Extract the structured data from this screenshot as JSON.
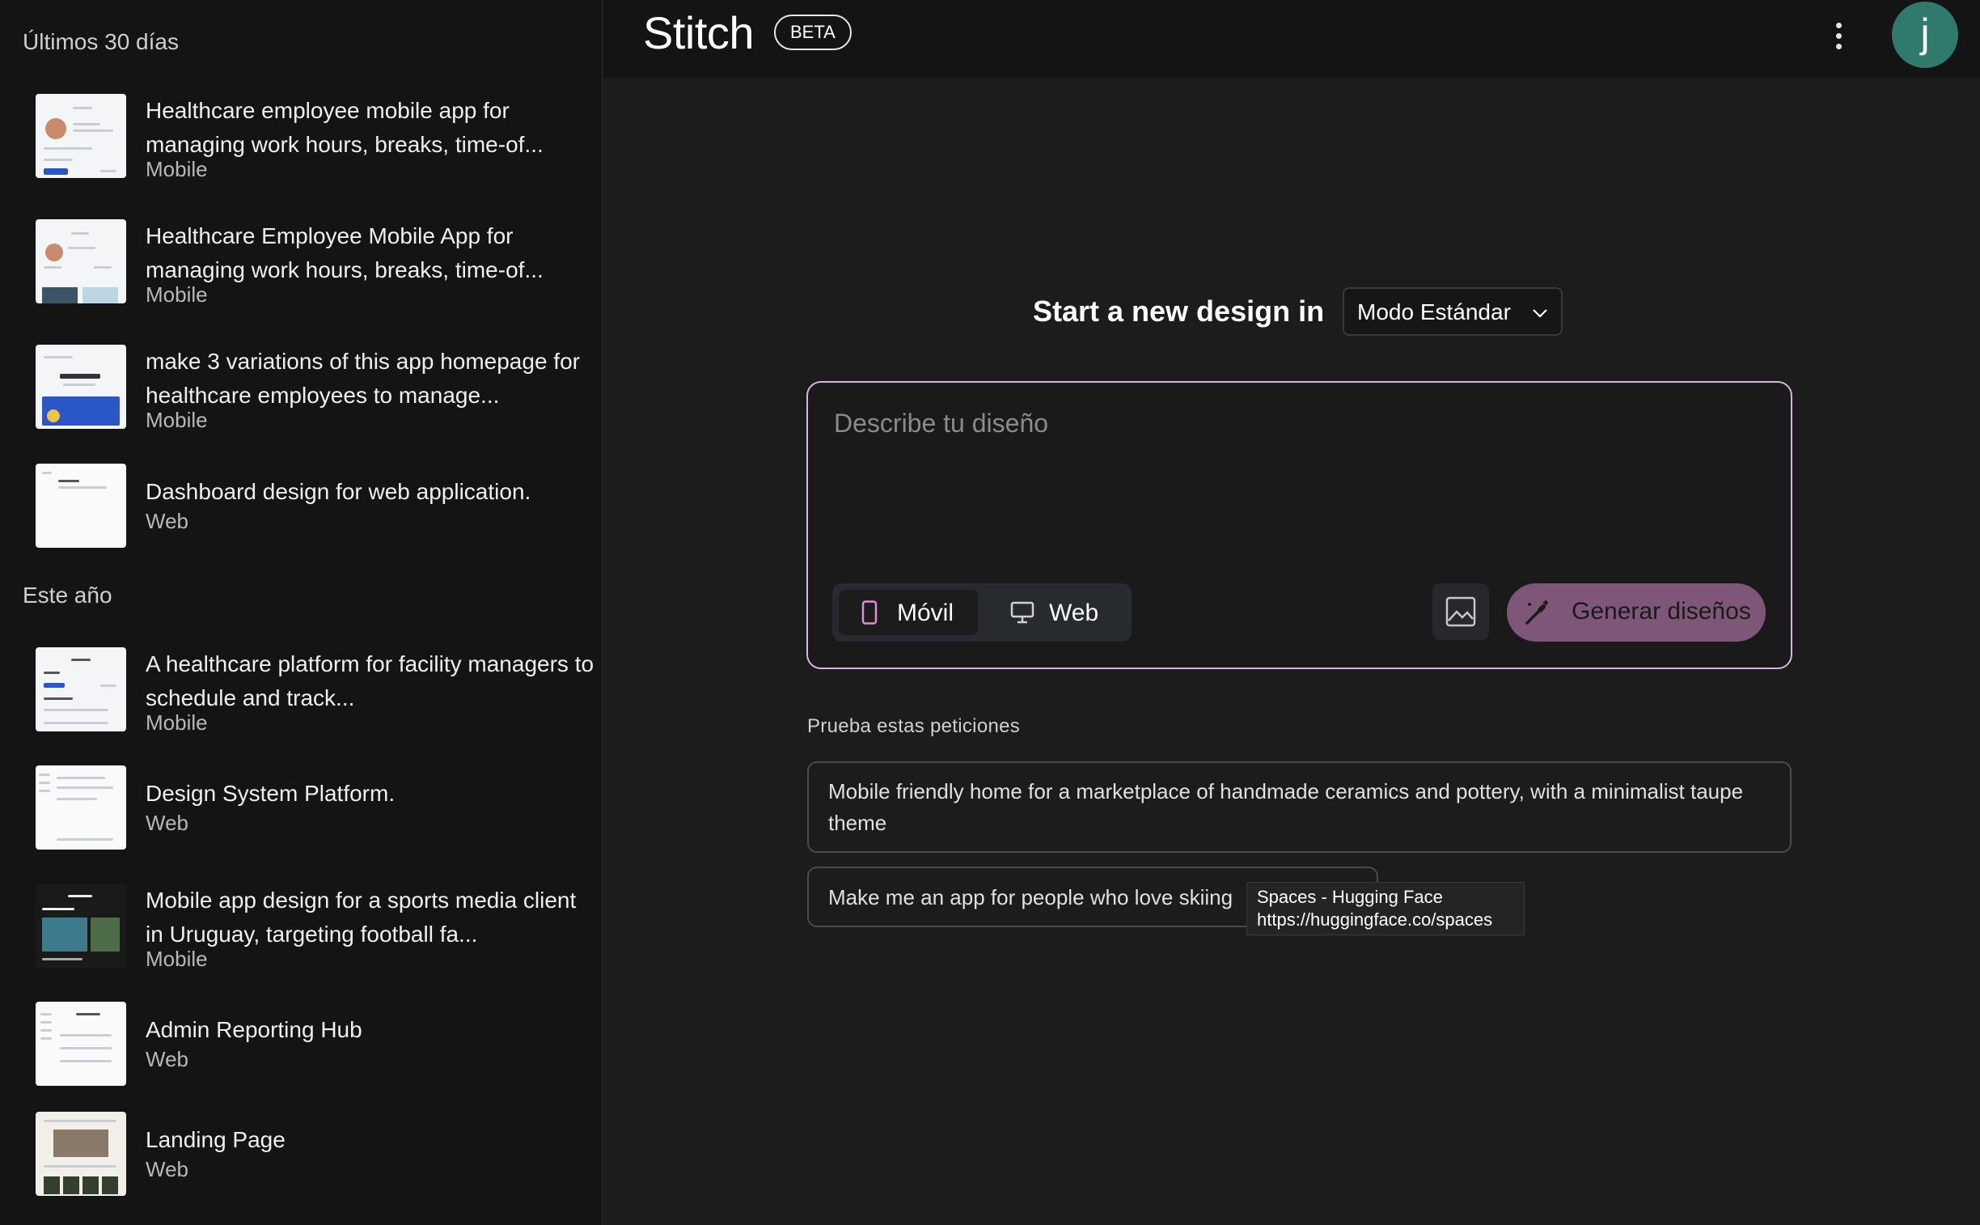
{
  "sidebar": {
    "sections": [
      {
        "title": "Últimos 30 días",
        "items": [
          {
            "title": "Healthcare employee mobile app for managing work hours, breaks, time-of...",
            "type": "Mobile"
          },
          {
            "title": "Healthcare Employee Mobile App for managing work hours, breaks, time-of...",
            "type": "Mobile"
          },
          {
            "title": "make 3 variations of this app homepage for healthcare employees to manage...",
            "type": "Mobile"
          },
          {
            "title": "Dashboard design for web application.",
            "type": "Web"
          }
        ]
      },
      {
        "title": "Este año",
        "items": [
          {
            "title": "A healthcare platform for facility managers to schedule and track...",
            "type": "Mobile"
          },
          {
            "title": "Design System Platform.",
            "type": "Web"
          },
          {
            "title": "Mobile app design for a sports media client in Uruguay, targeting football fa...",
            "type": "Mobile"
          },
          {
            "title": "Admin Reporting Hub",
            "type": "Web"
          },
          {
            "title": "Landing Page",
            "type": "Web"
          }
        ]
      }
    ]
  },
  "header": {
    "logo": "Stitch",
    "badge": "BETA",
    "menu_icon": "more-vert-icon",
    "avatar_letter": "j",
    "avatar_color": "#2f7a6c"
  },
  "main": {
    "heading": "Start a new design in",
    "mode_select": {
      "value": "Modo Estándar"
    },
    "prompt": {
      "placeholder": "Describe tu diseño",
      "value": ""
    },
    "device_toggle": {
      "mobile_label": "Móvil",
      "web_label": "Web",
      "selected": "Móvil"
    },
    "image_button_icon": "image-icon",
    "generate_label": "Generar diseños",
    "accent_color": "#d8b4e2",
    "suggestions_title": "Prueba estas peticiones",
    "suggestions": [
      "Mobile friendly home for a marketplace of handmade ceramics and pottery, with a minimalist taupe theme",
      "Make me an app for people who love skiing"
    ]
  },
  "tooltip": {
    "title": "Spaces - Hugging Face",
    "url": "https://huggingface.co/spaces"
  }
}
